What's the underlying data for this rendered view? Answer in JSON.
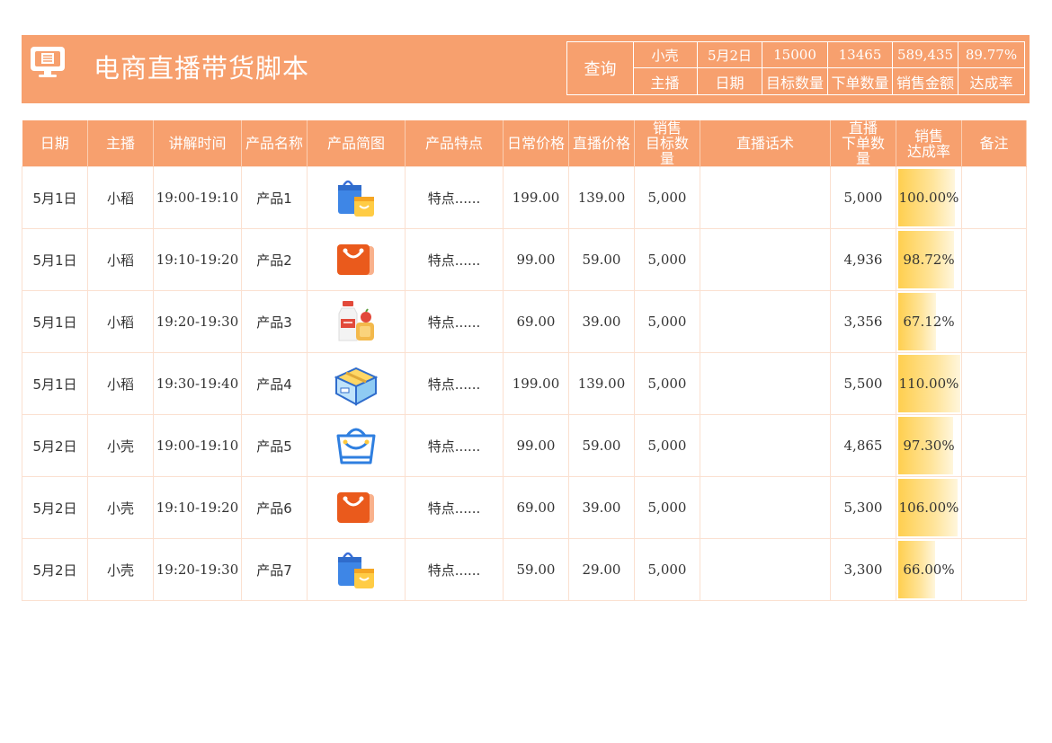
{
  "header": {
    "title": "电商直播带货脚本",
    "query_label": "查询",
    "summary": [
      {
        "label": "主播",
        "value": "小壳"
      },
      {
        "label": "日期",
        "value": "5月2日"
      },
      {
        "label": "目标数量",
        "value": "15000"
      },
      {
        "label": "下单数量",
        "value": "13465"
      },
      {
        "label": "销售金额",
        "value": "589,435"
      },
      {
        "label": "达成率",
        "value": "89.77%"
      }
    ]
  },
  "table": {
    "columns": [
      "日期",
      "主播",
      "讲解时间",
      "产品名称",
      "产品简图",
      "产品特点",
      "日常价格",
      "直播价格",
      "销售\n目标数\n量",
      "直播话术",
      "直播\n下单数\n量",
      "销售\n达成率",
      "备注"
    ],
    "rows": [
      {
        "date": "5月1日",
        "host": "小稻",
        "time": "19:00-19:10",
        "product": "产品1",
        "image": "blue-shopping-bag-icon",
        "feature": "特点......",
        "regular_price": "199.00",
        "live_price": "139.00",
        "target": "5,000",
        "script": "",
        "orders": "5,000",
        "rate": "100.00%",
        "rate_value": 1.0,
        "note": ""
      },
      {
        "date": "5月1日",
        "host": "小稻",
        "time": "19:10-19:20",
        "product": "产品2",
        "image": "orange-shopping-bag-icon",
        "feature": "特点......",
        "regular_price": "99.00",
        "live_price": "59.00",
        "target": "5,000",
        "script": "",
        "orders": "4,936",
        "rate": "98.72%",
        "rate_value": 0.9872,
        "note": ""
      },
      {
        "date": "5月1日",
        "host": "小稻",
        "time": "19:20-19:30",
        "product": "产品3",
        "image": "milk-bread-icon",
        "feature": "特点......",
        "regular_price": "69.00",
        "live_price": "39.00",
        "target": "5,000",
        "script": "",
        "orders": "3,356",
        "rate": "67.12%",
        "rate_value": 0.6712,
        "note": ""
      },
      {
        "date": "5月1日",
        "host": "小稻",
        "time": "19:30-19:40",
        "product": "产品4",
        "image": "package-box-icon",
        "feature": "特点......",
        "regular_price": "199.00",
        "live_price": "139.00",
        "target": "5,000",
        "script": "",
        "orders": "5,500",
        "rate": "110.00%",
        "rate_value": 1.1,
        "note": ""
      },
      {
        "date": "5月2日",
        "host": "小壳",
        "time": "19:00-19:10",
        "product": "产品5",
        "image": "blue-outline-bag-icon",
        "feature": "特点......",
        "regular_price": "99.00",
        "live_price": "59.00",
        "target": "5,000",
        "script": "",
        "orders": "4,865",
        "rate": "97.30%",
        "rate_value": 0.973,
        "note": ""
      },
      {
        "date": "5月2日",
        "host": "小壳",
        "time": "19:10-19:20",
        "product": "产品6",
        "image": "orange-shopping-bag-icon",
        "feature": "特点......",
        "regular_price": "69.00",
        "live_price": "39.00",
        "target": "5,000",
        "script": "",
        "orders": "5,300",
        "rate": "106.00%",
        "rate_value": 1.06,
        "note": ""
      },
      {
        "date": "5月2日",
        "host": "小壳",
        "time": "19:20-19:30",
        "product": "产品7",
        "image": "blue-shopping-bag-icon",
        "feature": "特点......",
        "regular_price": "59.00",
        "live_price": "29.00",
        "target": "5,000",
        "script": "",
        "orders": "3,300",
        "rate": "66.00%",
        "rate_value": 0.66,
        "note": ""
      }
    ]
  },
  "colors": {
    "accent": "#f7a06e",
    "bar": "#ffcf4f",
    "grid": "#fbe0d0"
  }
}
